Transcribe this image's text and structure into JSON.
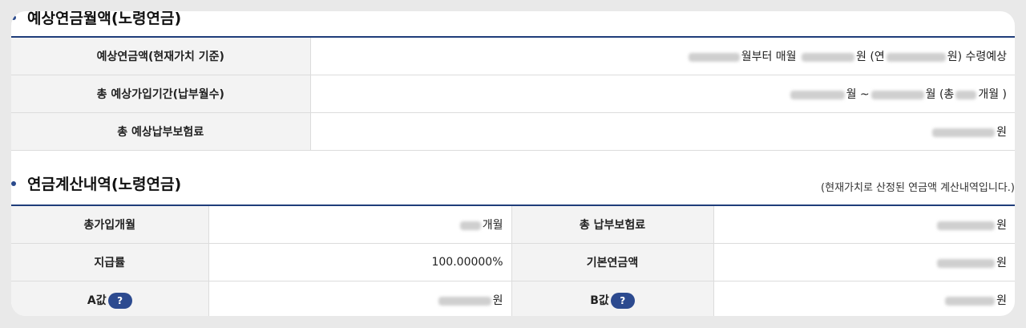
{
  "section1": {
    "title": "예상연금월액(노령연금)",
    "rows": [
      {
        "label": "예상연금액(현재가치 기준)",
        "text1": "월부터 매월",
        "text2": "원 (연",
        "text3": "원) 수령예상"
      },
      {
        "label": "총 예상가입기간(납부월수)",
        "text1": "월 ~",
        "text2": "월 (총",
        "text3": "개월 )"
      },
      {
        "label": "총 예상납부보험료",
        "text1": "원"
      }
    ]
  },
  "section2": {
    "title": "연금계산내역(노령연금)",
    "note": "(현재가치로 산정된 연금액 계산내역입니다.)",
    "rows": [
      {
        "label1": "총가입개월",
        "value1_suffix": "개월",
        "label2": "총 납부보험료",
        "value2_suffix": "원"
      },
      {
        "label1": "지급률",
        "value1": "100.00000%",
        "label2": "기본연금액",
        "value2_suffix": "원"
      },
      {
        "label1": "A값",
        "value1_suffix": "원",
        "label2": "B값",
        "value2_suffix": "원"
      }
    ],
    "help_label": "?"
  }
}
